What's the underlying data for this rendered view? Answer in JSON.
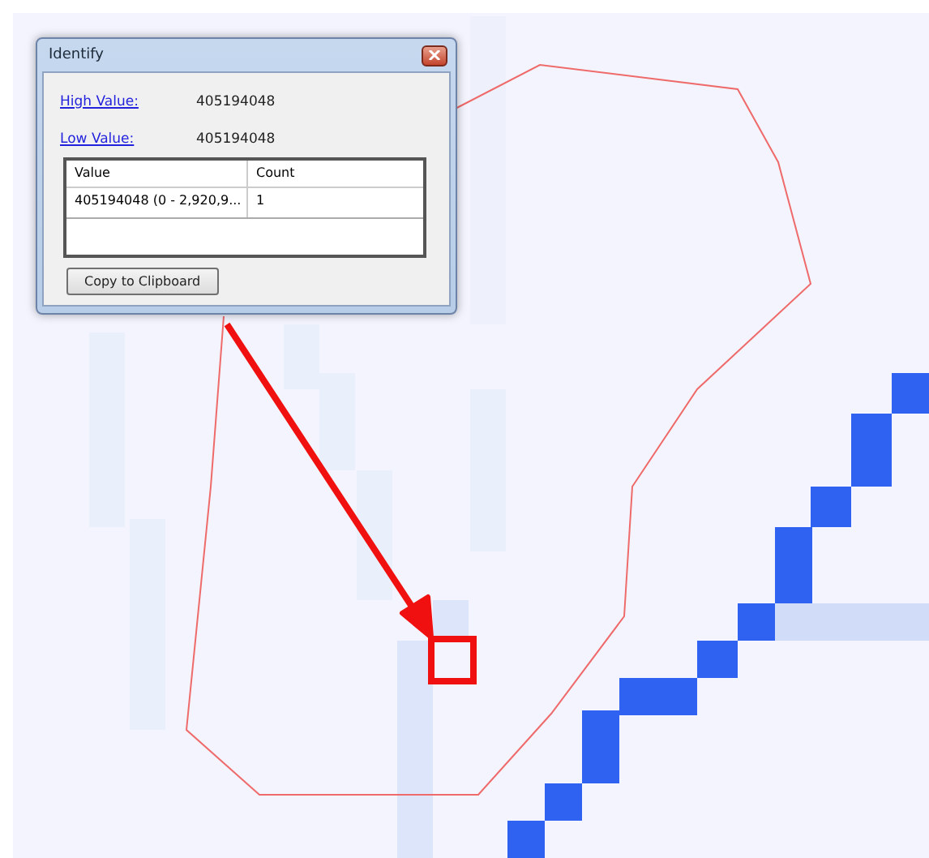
{
  "window": {
    "title": "Identify"
  },
  "fields": [
    {
      "label": "High Value:",
      "value": "405194048"
    },
    {
      "label": "Low Value:",
      "value": "405194048"
    }
  ],
  "table": {
    "columns": [
      "Value",
      "Count"
    ],
    "rows": [
      [
        "405194048 (0 - 2,920,9...",
        "1"
      ]
    ]
  },
  "buttons": [
    "Copy to Clipboard"
  ]
}
